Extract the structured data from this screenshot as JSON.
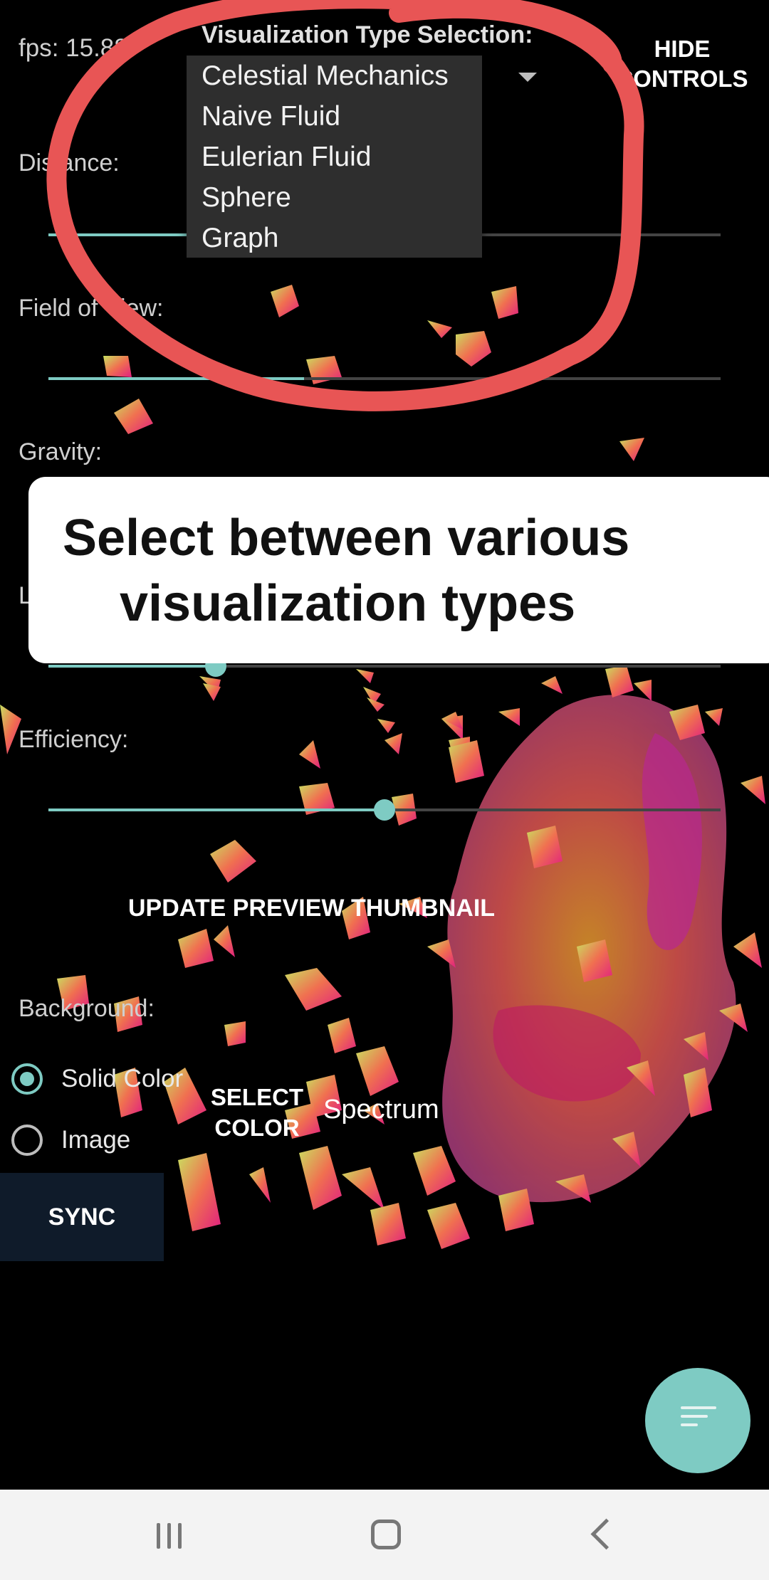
{
  "status": {
    "fps": "fps: 15.88"
  },
  "visualization": {
    "label": "Visualization Type Selection:",
    "options": [
      "Celestial Mechanics",
      "Naive Fluid",
      "Eulerian Fluid",
      "Sphere",
      "Graph"
    ],
    "selected": "Celestial Mechanics"
  },
  "header": {
    "hide_controls_line1": "HIDE",
    "hide_controls_line2": "CONTROLS"
  },
  "sliders": {
    "distance": {
      "label": "Distance:",
      "value": 0.22
    },
    "field_of_view": {
      "label": "Field of View:",
      "value": 0.38
    },
    "gravity": {
      "label": "Gravity:"
    },
    "lifetime": {
      "label": "L",
      "value": 0.25
    },
    "efficiency": {
      "label": "Efficiency:",
      "value": 0.5
    }
  },
  "tooltip": {
    "line1": "Select between various",
    "line2": "visualization types"
  },
  "update_button": "UPDATE PREVIEW THUMBNAIL",
  "background": {
    "label": "Background:",
    "options": [
      {
        "label": "Solid Color",
        "checked": true
      },
      {
        "label": "Image",
        "checked": false
      }
    ],
    "select_color_line1": "SELECT",
    "select_color_line2": "COLOR",
    "color_name": "Spectrum"
  },
  "sync_button": "SYNC",
  "colors": {
    "accent": "#7ecbc3",
    "annotation": "#e85555",
    "sync_bg": "#0f1b2a"
  },
  "icons": {
    "fab": "sort-lines-icon",
    "nav_recents": "recents-icon",
    "nav_home": "home-icon",
    "nav_back": "back-icon"
  }
}
